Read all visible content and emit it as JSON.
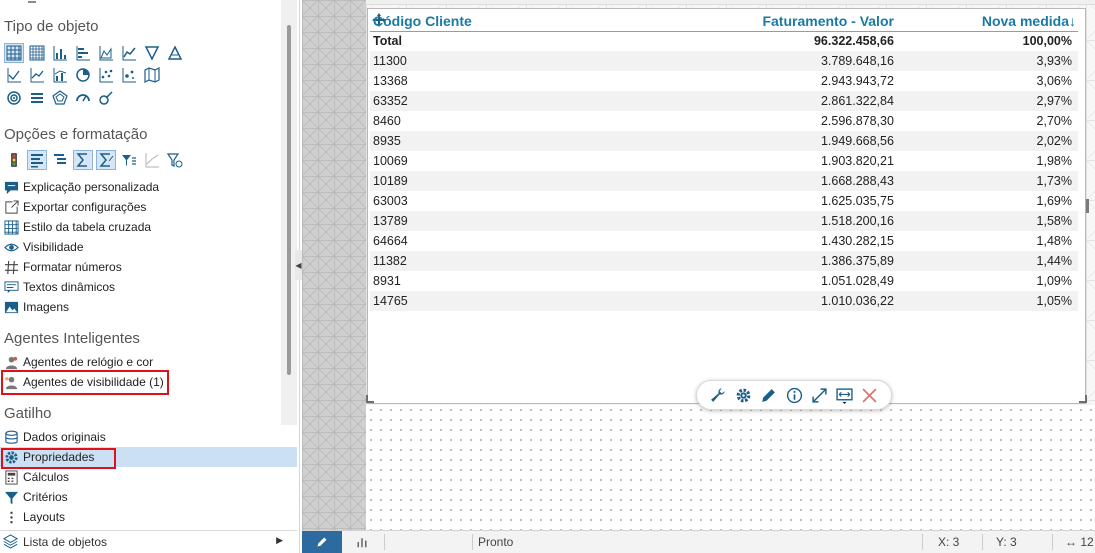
{
  "left_panel": {
    "sections": {
      "object_type": "Tipo de objeto",
      "options": "Opções e formatação",
      "agents": "Agentes Inteligentes",
      "trigger": "Gatilho"
    },
    "options_items": [
      {
        "label": "Explicação personalizada",
        "icon": "comment-icon"
      },
      {
        "label": "Exportar configurações",
        "icon": "export-icon"
      },
      {
        "label": "Estilo da tabela cruzada",
        "icon": "table-style-icon"
      },
      {
        "label": "Visibilidade",
        "icon": "eye-icon"
      },
      {
        "label": "Formatar números",
        "icon": "hash-icon"
      },
      {
        "label": "Textos dinâmicos",
        "icon": "dynamic-text-icon"
      },
      {
        "label": "Imagens",
        "icon": "image-icon"
      }
    ],
    "agent_items": [
      {
        "label": "Agentes de relógio e cor",
        "icon": "agent-clock-icon"
      },
      {
        "label": "Agentes de visibilidade (1)",
        "icon": "agent-visibility-icon"
      }
    ],
    "trigger_items": [
      {
        "label": "Dados originais",
        "icon": "database-icon"
      },
      {
        "label": "Propriedades",
        "icon": "gear-icon"
      },
      {
        "label": "Cálculos",
        "icon": "calculator-icon"
      },
      {
        "label": "Critérios",
        "icon": "filter-icon"
      },
      {
        "label": "Layouts",
        "icon": "layout-icon"
      }
    ],
    "bottom": {
      "label": "Lista de objetos",
      "icon": "layers-icon"
    }
  },
  "table": {
    "headers": [
      "Código Cliente",
      "Faturamento - Valor",
      "Nova medida"
    ],
    "total": {
      "label": "Total",
      "value": "96.322.458,66",
      "percent": "100,00%"
    },
    "rows": [
      [
        "11300",
        "3.789.648,16",
        "3,93%"
      ],
      [
        "13368",
        "2.943.943,72",
        "3,06%"
      ],
      [
        "63352",
        "2.861.322,84",
        "2,97%"
      ],
      [
        "8460",
        "2.596.878,30",
        "2,70%"
      ],
      [
        "8935",
        "1.949.668,56",
        "2,02%"
      ],
      [
        "10069",
        "1.903.820,21",
        "1,98%"
      ],
      [
        "10189",
        "1.668.288,43",
        "1,73%"
      ],
      [
        "63003",
        "1.625.035,75",
        "1,69%"
      ],
      [
        "13789",
        "1.518.200,16",
        "1,58%"
      ],
      [
        "64664",
        "1.430.282,15",
        "1,48%"
      ],
      [
        "11382",
        "1.386.375,89",
        "1,44%"
      ],
      [
        "8931",
        "1.051.028,49",
        "1,09%"
      ],
      [
        "14765",
        "1.010.036,22",
        "1,05%"
      ]
    ]
  },
  "floating_toolbar": [
    "wrench-icon",
    "gear-icon",
    "pencil-icon",
    "info-icon",
    "expand-icon",
    "fit-width-icon",
    "close-icon"
  ],
  "status_bar": {
    "status": "Pronto",
    "x": "X: 3",
    "y": "Y: 3",
    "width_partial": "↔ 12"
  },
  "colors": {
    "header_text": "#1a7aa3",
    "highlight": "#e0101b",
    "active_tab": "#2d6aa0",
    "selected_row": "#cce0f4",
    "icon_blue": "#1b5e8a"
  }
}
